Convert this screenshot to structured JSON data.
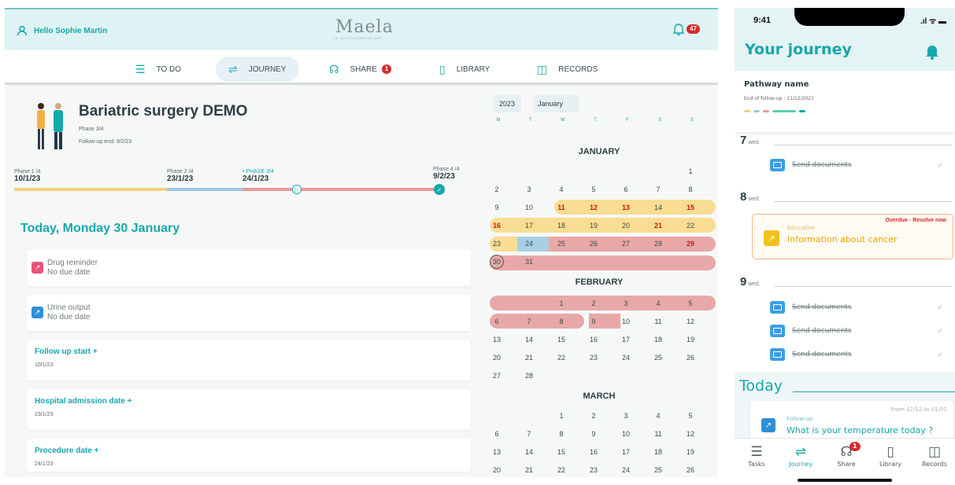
{
  "desktop": {
    "greeting": "Hello Sophie Martin",
    "logo": "Maela",
    "logo_sub": "LE SUIVI ENDOSCOPIQUE",
    "notif_count": "47",
    "nav": [
      {
        "label": "TO DO",
        "icon": "list-icon"
      },
      {
        "label": "JOURNEY",
        "icon": "route-icon",
        "active": true
      },
      {
        "label": "SHARE",
        "icon": "share-icon",
        "badge": "1"
      },
      {
        "label": "LIBRARY",
        "icon": "book-icon"
      },
      {
        "label": "RECORDS",
        "icon": "chart-icon"
      }
    ],
    "course": {
      "title": "Bariatric surgery DEMO",
      "phase": "Phase 3/4",
      "follow_end": "Follow-up end: 9/2/23",
      "phases": [
        {
          "label": "Phase 1 /4",
          "date": "10/1/23",
          "color": "#f2d27f"
        },
        {
          "label": "Phase 2 /4",
          "date": "23/1/23",
          "color": "#9ec9e2"
        },
        {
          "label": "• PHASE 3/4",
          "date": "24/1/23",
          "color": "#e79a9a"
        },
        {
          "label": "Phase 4 /4",
          "date": "9/2/23",
          "color": "#e79a9a"
        }
      ],
      "progress": 0.66
    },
    "today_title": "Today, Monday 30 January",
    "cards": [
      {
        "title": "Drug reminder",
        "sub": "No due date",
        "color": "#e8537a"
      },
      {
        "title": "Urine output",
        "sub": "No due date",
        "color": "#2f8fd8"
      }
    ],
    "dates": [
      {
        "title": "Follow up start +",
        "value": "10/1/23"
      },
      {
        "title": "Hospital admission date +",
        "value": "23/1/23"
      },
      {
        "title": "Procedure date +",
        "value": "24/1/23"
      }
    ]
  },
  "calendar": {
    "year": "2023",
    "month": "January",
    "weekdays": [
      "M",
      "T",
      "W",
      "T",
      "F",
      "S",
      "S"
    ],
    "months": [
      "JANUARY",
      "FEBRUARY",
      "MARCH"
    ],
    "jan": [
      [
        "",
        "",
        "",
        "",
        "",
        "",
        "1"
      ],
      [
        "2",
        "3",
        "4",
        "5",
        "6",
        "7",
        "8"
      ],
      [
        "9",
        "10",
        "11",
        "12",
        "13",
        "14",
        "15"
      ],
      [
        "16",
        "17",
        "18",
        "19",
        "20",
        "21",
        "22"
      ],
      [
        "23",
        "24",
        "25",
        "26",
        "27",
        "28",
        "29"
      ],
      [
        "30",
        "31",
        "",
        "",
        "",
        "",
        ""
      ]
    ],
    "feb": [
      [
        "",
        "",
        "1",
        "2",
        "3",
        "4",
        "5"
      ],
      [
        "6",
        "7",
        "8",
        "9",
        "10",
        "11",
        "12"
      ],
      [
        "13",
        "14",
        "15",
        "16",
        "17",
        "18",
        "19"
      ],
      [
        "20",
        "21",
        "22",
        "23",
        "24",
        "25",
        "26"
      ],
      [
        "27",
        "28",
        "",
        "",
        "",
        "",
        ""
      ]
    ],
    "mar": [
      [
        "",
        "",
        "1",
        "2",
        "3",
        "4",
        "5"
      ],
      [
        "6",
        "7",
        "8",
        "9",
        "10",
        "11",
        "12"
      ],
      [
        "13",
        "14",
        "15",
        "16",
        "17",
        "18",
        "19"
      ],
      [
        "20",
        "21",
        "22",
        "23",
        "24",
        "25",
        "26"
      ]
    ],
    "highlight_red": [
      "11",
      "12",
      "13",
      "15",
      "16",
      "21",
      "29"
    ],
    "today": "30"
  },
  "phone": {
    "time": "9:41",
    "signal": ".ıl ᯤ ▬",
    "title": "Your journey",
    "pathway": "Pathway name",
    "end": "End of follow-up : 11/12/2021",
    "days": [
      {
        "num": "7",
        "wd": "wed."
      },
      {
        "num": "8",
        "wd": "wed."
      },
      {
        "num": "9",
        "wd": "wed."
      }
    ],
    "task_label": "Send documents",
    "check": "✓",
    "overdue": {
      "category": "Education",
      "title": "Information about cancer",
      "status": "Overdue - Resolve now"
    },
    "today": "Today",
    "follow": {
      "category": "Follow-up",
      "range": "From 12/12 to 01/01",
      "title": "What is your temperature today ?"
    },
    "tabs": [
      {
        "label": "Tasks",
        "icon": "☰"
      },
      {
        "label": "Journey",
        "icon": "⇌",
        "active": true
      },
      {
        "label": "Share",
        "icon": "☊",
        "badge": "1"
      },
      {
        "label": "Library",
        "icon": "▯"
      },
      {
        "label": "Records",
        "icon": "◫"
      }
    ]
  }
}
